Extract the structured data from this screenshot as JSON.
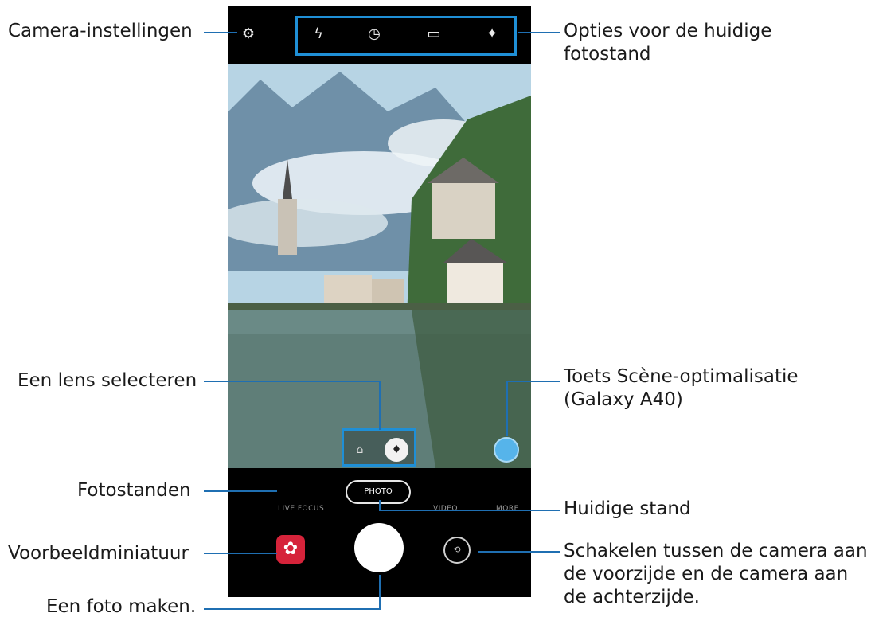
{
  "callouts": {
    "camera_settings": "Camera-instellingen",
    "options_line1": "Opties voor de huidige",
    "options_line2": "fotostand",
    "lens_select": "Een lens selecteren",
    "scene_line1": "Toets Scène-optimalisatie",
    "scene_line2": "(Galaxy A40)",
    "photo_modes": "Fotostanden",
    "current_mode": "Huidige stand",
    "preview_thumb": "Voorbeeldminiatuur",
    "switch_line1": "Schakelen tussen de camera aan",
    "switch_line2": "de voorzijde en de camera aan",
    "switch_line3": "de achterzijde.",
    "take_photo": "Een foto maken."
  },
  "phone": {
    "icons": {
      "settings": "gear-icon",
      "flash": "flash-icon",
      "timer": "timer-icon",
      "ratio": "aspect-ratio-icon",
      "filter": "filter-icon",
      "thumbnail": "flower-icon",
      "switch": "switch-camera-icon",
      "lens_wide": "wide-lens-icon",
      "lens_normal": "standard-lens-icon",
      "scene": "scene-optimizer-icon"
    },
    "modes": [
      "LIVE FOCUS",
      "PHOTO",
      "VIDEO",
      "MORE"
    ],
    "current_mode": "PHOTO"
  },
  "colors": {
    "accent": "#1f8fd6",
    "callout_line": "#1f6fb2",
    "thumbnail": "#d6233a",
    "scene_button": "#56b4ea"
  }
}
